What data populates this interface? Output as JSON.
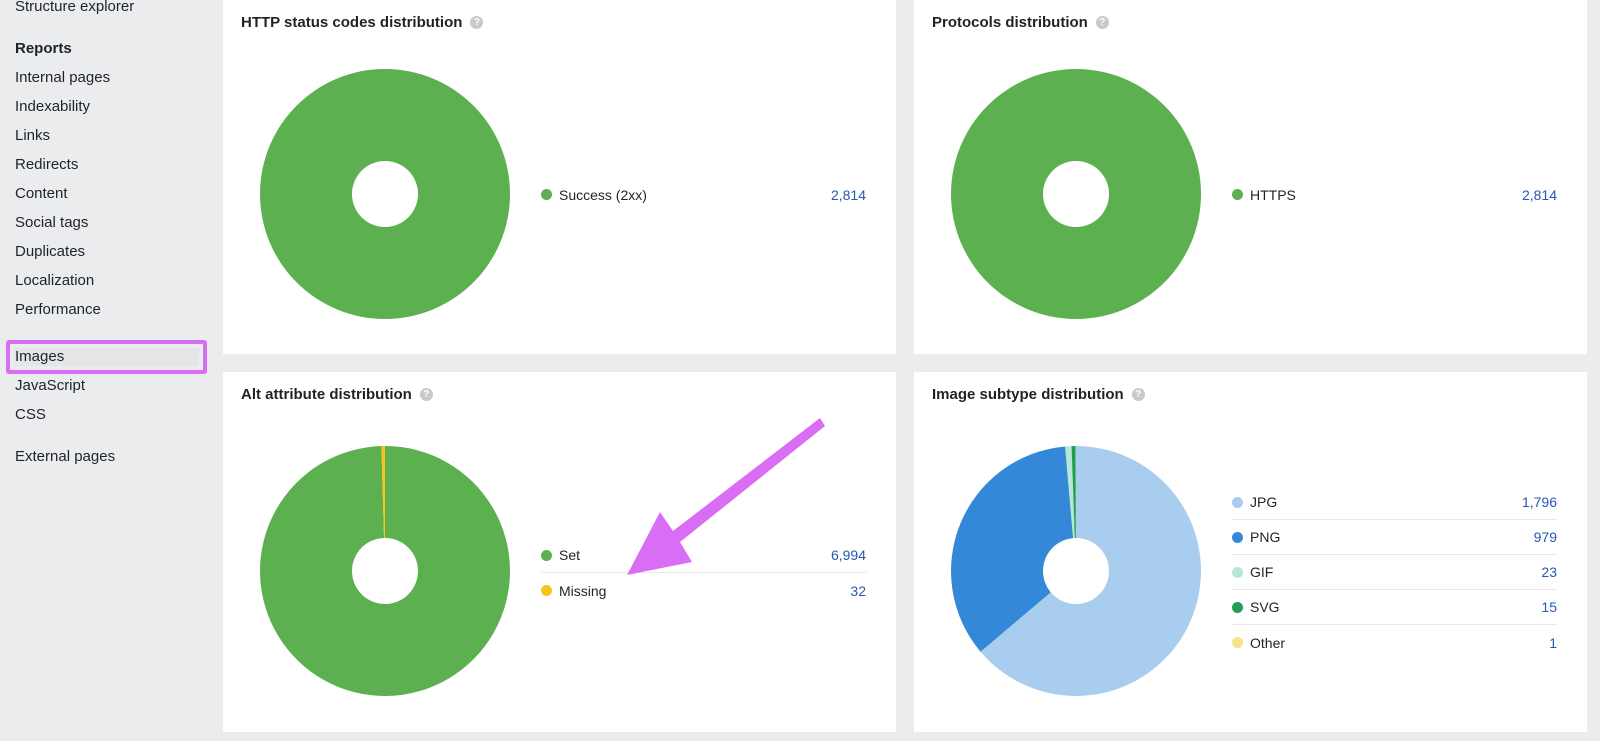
{
  "sidebar": {
    "structure_explorer": "Structure explorer",
    "reports_heading": "Reports",
    "items": [
      "Internal pages",
      "Indexability",
      "Links",
      "Redirects",
      "Content",
      "Social tags",
      "Duplicates",
      "Localization",
      "Performance"
    ],
    "images": "Images",
    "items2": [
      "JavaScript",
      "CSS"
    ],
    "external_pages": "External pages"
  },
  "panels": {
    "http": {
      "title": "HTTP status codes distribution",
      "help": "?",
      "legend": [
        {
          "label": "Success (2xx)",
          "value": "2,814",
          "color": "#5cb050"
        }
      ]
    },
    "protocols": {
      "title": "Protocols distribution",
      "help": "?",
      "legend": [
        {
          "label": "HTTPS",
          "value": "2,814",
          "color": "#5cb050"
        }
      ]
    },
    "alt": {
      "title": "Alt attribute distribution",
      "help": "?",
      "legend": [
        {
          "label": "Set",
          "value": "6,994",
          "color": "#5cb050"
        },
        {
          "label": "Missing",
          "value": "32",
          "color": "#f5c518"
        }
      ]
    },
    "subtype": {
      "title": "Image subtype distribution",
      "help": "?",
      "legend": [
        {
          "label": "JPG",
          "value": "1,796",
          "color": "#a8cdef"
        },
        {
          "label": "PNG",
          "value": "979",
          "color": "#3389d8"
        },
        {
          "label": "GIF",
          "value": "23",
          "color": "#b5e6d6"
        },
        {
          "label": "SVG",
          "value": "15",
          "color": "#1f9e57"
        },
        {
          "label": "Other",
          "value": "1",
          "color": "#f9e08a"
        }
      ]
    }
  },
  "chart_data": [
    {
      "type": "pie",
      "title": "HTTP status codes distribution",
      "categories": [
        "Success (2xx)"
      ],
      "values": [
        2814
      ],
      "colors": [
        "#5cb050"
      ]
    },
    {
      "type": "pie",
      "title": "Protocols distribution",
      "categories": [
        "HTTPS"
      ],
      "values": [
        2814
      ],
      "colors": [
        "#5cb050"
      ]
    },
    {
      "type": "pie",
      "title": "Alt attribute distribution",
      "categories": [
        "Set",
        "Missing"
      ],
      "values": [
        6994,
        32
      ],
      "colors": [
        "#5cb050",
        "#f5c518"
      ]
    },
    {
      "type": "pie",
      "title": "Image subtype distribution",
      "categories": [
        "JPG",
        "PNG",
        "GIF",
        "SVG",
        "Other"
      ],
      "values": [
        1796,
        979,
        23,
        15,
        1
      ],
      "colors": [
        "#a8cdef",
        "#3389d8",
        "#b5e6d6",
        "#1f9e57",
        "#f9e08a"
      ]
    }
  ],
  "annotation": {
    "highlight_color": "#d96ef4",
    "arrow_color": "#d96ef4"
  }
}
